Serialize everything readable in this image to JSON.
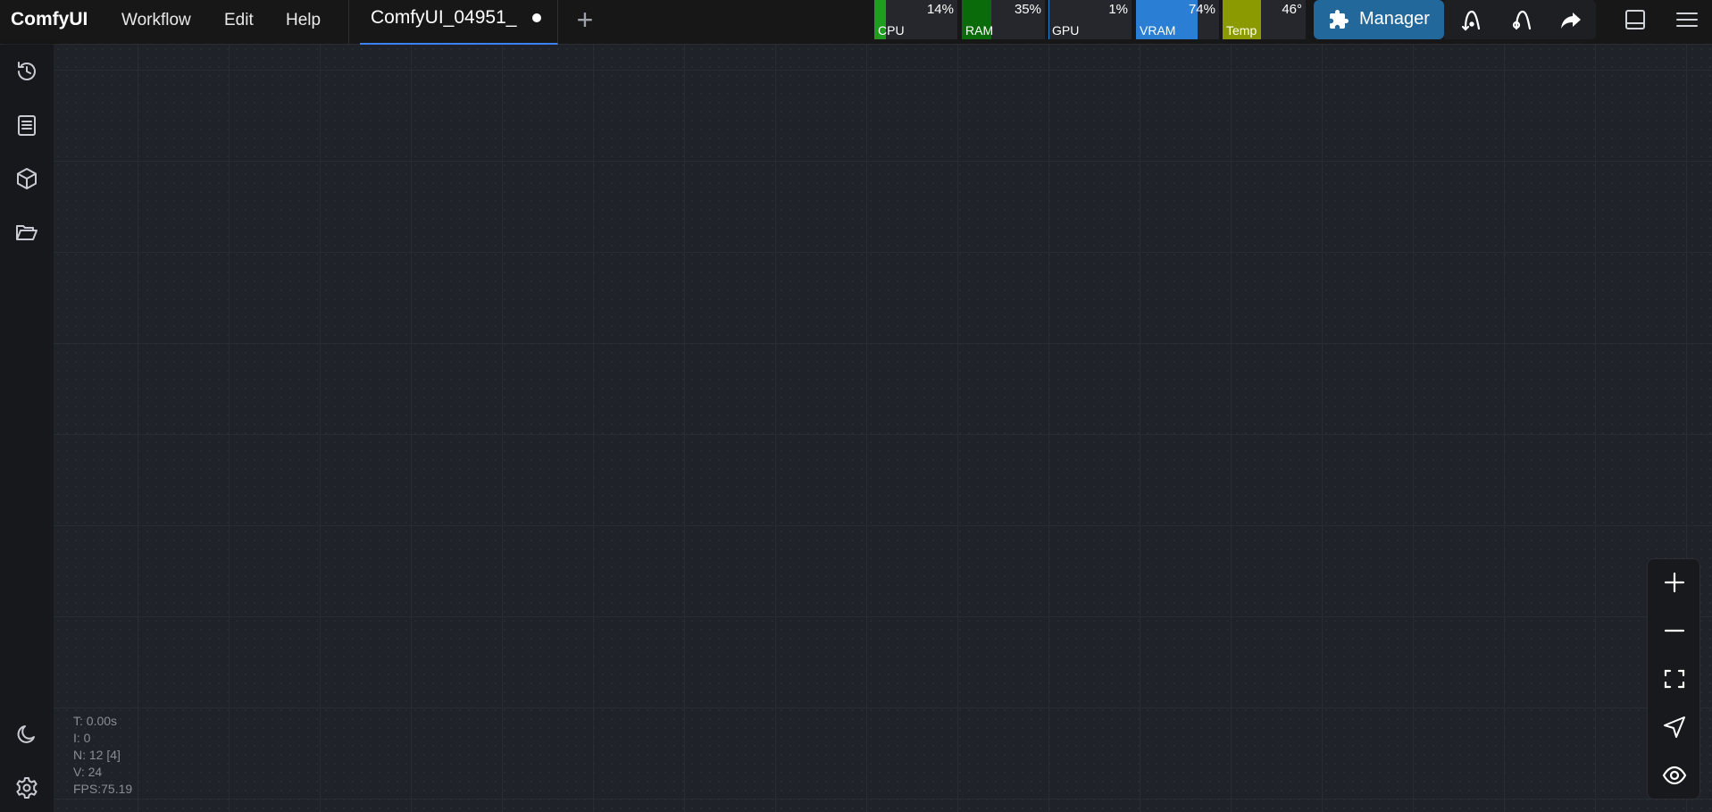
{
  "topbar": {
    "brand": "ComfyUI",
    "menu": [
      "Workflow",
      "Edit",
      "Help"
    ],
    "tab": {
      "label": "ComfyUI_04951_",
      "modified": true
    },
    "new_tab": "+"
  },
  "monitors": [
    {
      "name": "CPU",
      "value": "14%",
      "percent": 14,
      "color": "#1f9d1f"
    },
    {
      "name": "RAM",
      "value": "35%",
      "percent": 35,
      "color": "#0a6b0a"
    },
    {
      "name": "GPU",
      "value": "1%",
      "percent": 1,
      "color": "#2a7fd4"
    },
    {
      "name": "VRAM",
      "value": "74%",
      "percent": 74,
      "color": "#2a7fd4"
    },
    {
      "name": "Temp",
      "value": "46°",
      "percent": 46,
      "color": "#8a9a00"
    }
  ],
  "manager": {
    "label": "Manager",
    "color": "#23689b"
  },
  "icons": {
    "top_actions": [
      "queue-icon",
      "queue-front-icon",
      "share-icon",
      "bottom-panel-icon",
      "hamburger-menu-icon"
    ],
    "sidebar_top": [
      "history-icon",
      "node-library-icon",
      "model-library-icon",
      "workflows-folder-icon"
    ],
    "sidebar_bottom": [
      "theme-moon-icon",
      "settings-gear-icon"
    ],
    "zoom": [
      "zoom-in-icon",
      "zoom-out-icon",
      "fit-view-icon",
      "pointer-mode-icon",
      "link-visibility-icon"
    ]
  },
  "stats": {
    "t": "T: 0.00s",
    "i": "I: 0",
    "n": "N: 12 [4]",
    "v": "V: 24",
    "fps": "FPS:75.19"
  }
}
